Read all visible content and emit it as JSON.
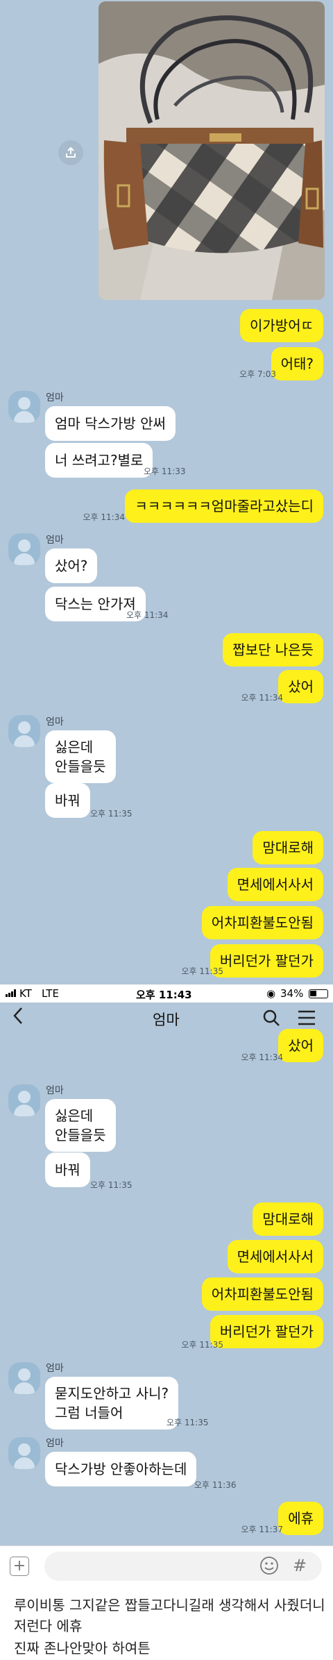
{
  "panel1": {
    "messages_me": [
      {
        "text": "이가방어ㄸ"
      },
      {
        "text": "어태?"
      },
      {
        "text": "ㅋㅋㅋㅋㅋㅋ엄마줄라고샀는디"
      },
      {
        "text": "짭보단 나은듯"
      },
      {
        "text": "샀어"
      },
      {
        "text": "맘대로해"
      },
      {
        "text": "면세에서사서"
      },
      {
        "text": "어차피환불도안됨"
      },
      {
        "text": "버리던가 팔던가"
      }
    ],
    "messages_other": [
      {
        "text": "엄마 닥스가방 안써"
      },
      {
        "text": "너 쓰려고?별로"
      },
      {
        "text": "샀어?"
      },
      {
        "text": "닥스는 안가져"
      },
      {
        "text": "싫은데\n안들을듯"
      },
      {
        "text": "바꿔"
      }
    ],
    "sender_name": "엄마",
    "times": [
      "오후 7:03",
      "오후 11:33",
      "오후 11:34",
      "오후 11:34",
      "오후 11:34",
      "오후 11:35",
      "오후 11:35"
    ],
    "share_icon": "share-icon"
  },
  "status_bar": {
    "carrier": "KT",
    "network": "LTE",
    "time": "오후 11:43",
    "battery": "34%"
  },
  "chat_header": {
    "title": "엄마",
    "back_icon": "back-arrow-icon",
    "search_icon": "search-icon",
    "menu_icon": "menu-icon"
  },
  "panel2": {
    "messages_me": [
      {
        "text": "샀어"
      },
      {
        "text": "맘대로해"
      },
      {
        "text": "면세에서사서"
      },
      {
        "text": "어차피환불도안됨"
      },
      {
        "text": "버리던가 팔던가"
      },
      {
        "text": "에휴"
      }
    ],
    "messages_other": [
      {
        "text": "싫은데\n안들을듯"
      },
      {
        "text": "바꿔"
      },
      {
        "text": "묻지도안하고 사니?\n그럼 너들어"
      },
      {
        "text": "닥스가방 안좋아하는데"
      }
    ],
    "sender_name": "엄마",
    "times": [
      "오후 11:34",
      "오후 11:35",
      "오후 11:35",
      "오후 11:35",
      "오후 11:36",
      "오후 11:37"
    ]
  },
  "input_bar": {
    "plus_icon": "plus-icon",
    "emoji_icon": "emoji-icon",
    "hash_icon": "hash-icon"
  },
  "caption": {
    "line1": "루이비통 그지같은 짭들고다니길래 생각해서 사줬더니",
    "line2": "저런다 에휴",
    "line3": "진짜 존나안맞아 하여튼"
  }
}
